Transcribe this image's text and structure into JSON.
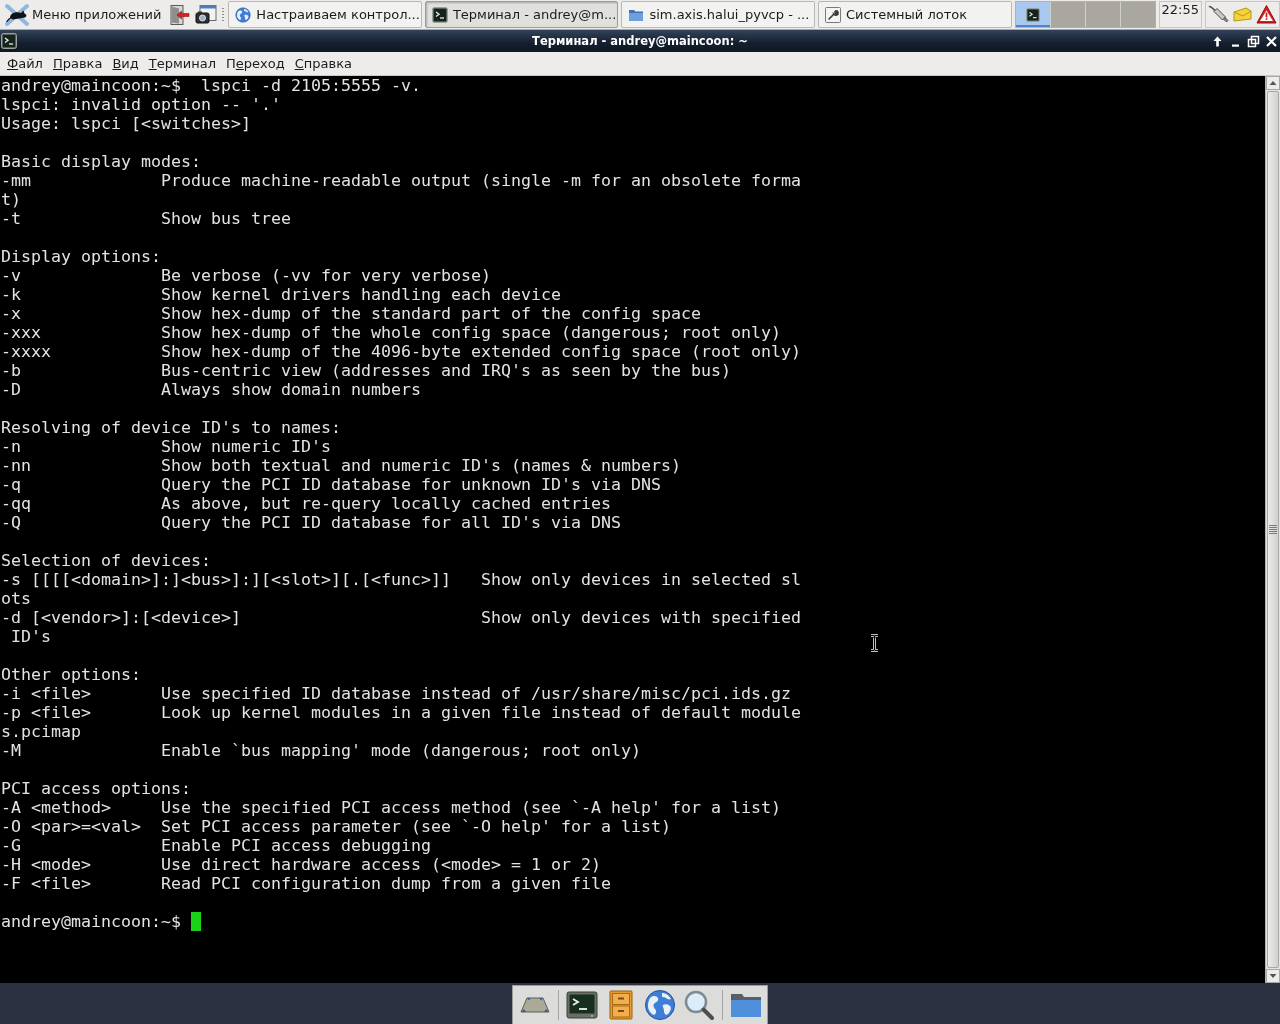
{
  "panel": {
    "menu_button": {
      "label": "Меню приложений"
    },
    "tasks": [
      {
        "kind": "browser",
        "label": "Настраиваем контрол...",
        "selected": false
      },
      {
        "kind": "terminal",
        "label": "Терминал - andrey@m...",
        "selected": true
      },
      {
        "kind": "folder",
        "label": "sim.axis.halui_pyvcp - ...",
        "selected": false
      },
      {
        "kind": "settings",
        "label": "Системный лоток",
        "selected": false
      }
    ],
    "workspaces": [
      {
        "selected": true
      },
      {
        "selected": false
      },
      {
        "selected": false
      },
      {
        "selected": false
      }
    ],
    "clock": "22:55"
  },
  "window": {
    "title": "Терминал - andrey@maincoon: ~"
  },
  "menu": [
    {
      "key": "Ф",
      "after": "айл"
    },
    {
      "key": "П",
      "after": "равка"
    },
    {
      "key": "В",
      "after": "ид"
    },
    {
      "key": "Т",
      "after": "ерминал"
    },
    {
      "before": "П",
      "key": "е",
      "after": "реход"
    },
    {
      "key": "С",
      "after": "правка"
    }
  ],
  "terminal": {
    "blocks": [
      {
        "lines": [
          "andrey@maincoon:~$  lspci -d 2105:5555 -v.",
          "lspci: invalid option -- '.'",
          "Usage: lspci [<switches>]"
        ]
      },
      {
        "lines": [
          "Basic display modes:",
          "-mm             Produce machine-readable output (single -m for an obsolete forma",
          "t)",
          "-t              Show bus tree"
        ]
      },
      {
        "lines": [
          "Display options:",
          "-v              Be verbose (-vv for very verbose)",
          "-k              Show kernel drivers handling each device",
          "-x              Show hex-dump of the standard part of the config space",
          "-xxx            Show hex-dump of the whole config space (dangerous; root only)",
          "-xxxx           Show hex-dump of the 4096-byte extended config space (root only)",
          "-b              Bus-centric view (addresses and IRQ's as seen by the bus)",
          "-D              Always show domain numbers"
        ]
      },
      {
        "lines": [
          "Resolving of device ID's to names:",
          "-n              Show numeric ID's",
          "-nn             Show both textual and numeric ID's (names & numbers)",
          "-q              Query the PCI ID database for unknown ID's via DNS",
          "-qq             As above, but re-query locally cached entries",
          "-Q              Query the PCI ID database for all ID's via DNS"
        ]
      },
      {
        "lines": [
          "Selection of devices:",
          "-s [[[[<domain>]:]<bus>]:][<slot>][.[<func>]]   Show only devices in selected sl",
          "ots",
          "-d [<vendor>]:[<device>]                        Show only devices with specified",
          " ID's"
        ]
      },
      {
        "lines": [
          "Other options:",
          "-i <file>       Use specified ID database instead of /usr/share/misc/pci.ids.gz",
          "-p <file>       Look up kernel modules in a given file instead of default module",
          "s.pcimap",
          "-M              Enable `bus mapping' mode (dangerous; root only)"
        ]
      },
      {
        "lines": [
          "PCI access options:",
          "-A <method>     Use the specified PCI access method (see `-A help' for a list)",
          "-O <par>=<val>  Set PCI access parameter (see `-O help' for a list)",
          "-G              Enable PCI access debugging",
          "-H <mode>       Use direct hardware access (<mode> = 1 or 2)",
          "-F <file>       Read PCI configuration dump from a given file"
        ]
      }
    ],
    "prompt": "andrey@maincoon:~$"
  }
}
